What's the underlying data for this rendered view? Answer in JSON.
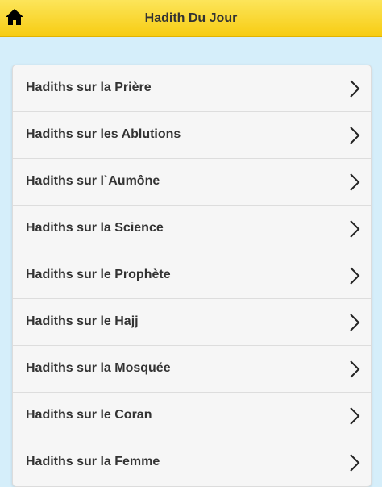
{
  "header": {
    "title": "Hadith Du Jour",
    "home_icon": "home-icon",
    "background_color": "#f9d424",
    "text_color": "#333333"
  },
  "page": {
    "background_color": "#d5eefa"
  },
  "list": {
    "chevron_icon": "chevron-right-icon",
    "items": [
      {
        "label": "Hadiths sur la Prière"
      },
      {
        "label": "Hadiths sur les Ablutions"
      },
      {
        "label": "Hadiths sur l`Aumône"
      },
      {
        "label": "Hadiths sur la Science"
      },
      {
        "label": "Hadiths sur le Prophète"
      },
      {
        "label": "Hadiths sur le Hajj"
      },
      {
        "label": "Hadiths sur la Mosquée"
      },
      {
        "label": "Hadiths sur le Coran"
      },
      {
        "label": "Hadiths sur la Femme"
      }
    ]
  }
}
